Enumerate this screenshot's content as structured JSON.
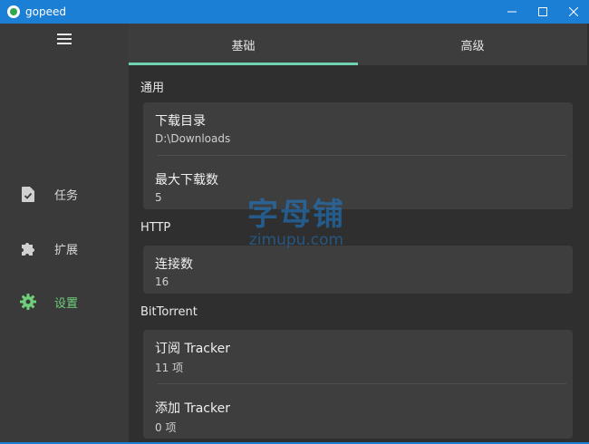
{
  "window": {
    "title": "gopeed"
  },
  "sidebar": {
    "items": [
      {
        "label": "任务",
        "icon": "task-icon",
        "active": false
      },
      {
        "label": "扩展",
        "icon": "puzzle-icon",
        "active": false
      },
      {
        "label": "设置",
        "icon": "gear-icon",
        "active": true
      }
    ]
  },
  "tabs": [
    {
      "label": "基础",
      "active": true
    },
    {
      "label": "高级",
      "active": false
    }
  ],
  "sections": [
    {
      "title": "通用",
      "rows": [
        {
          "name": "下载目录",
          "value": "D:\\Downloads"
        },
        {
          "name": "最大下载数",
          "value": "5"
        }
      ]
    },
    {
      "title": "HTTP",
      "rows": [
        {
          "name": "连接数",
          "value": "16"
        }
      ]
    },
    {
      "title": "BitTorrent",
      "rows": [
        {
          "name": "订阅 Tracker",
          "value": "11 项"
        },
        {
          "name": "添加 Tracker",
          "value": "0 项"
        }
      ]
    }
  ],
  "watermark": {
    "cn": "字母铺",
    "en": "zimupu.com"
  },
  "colors": {
    "titlebar": "#1b7fd6",
    "accent_green": "#6fcf7a",
    "tab_indicator": "#6fd3b0"
  }
}
